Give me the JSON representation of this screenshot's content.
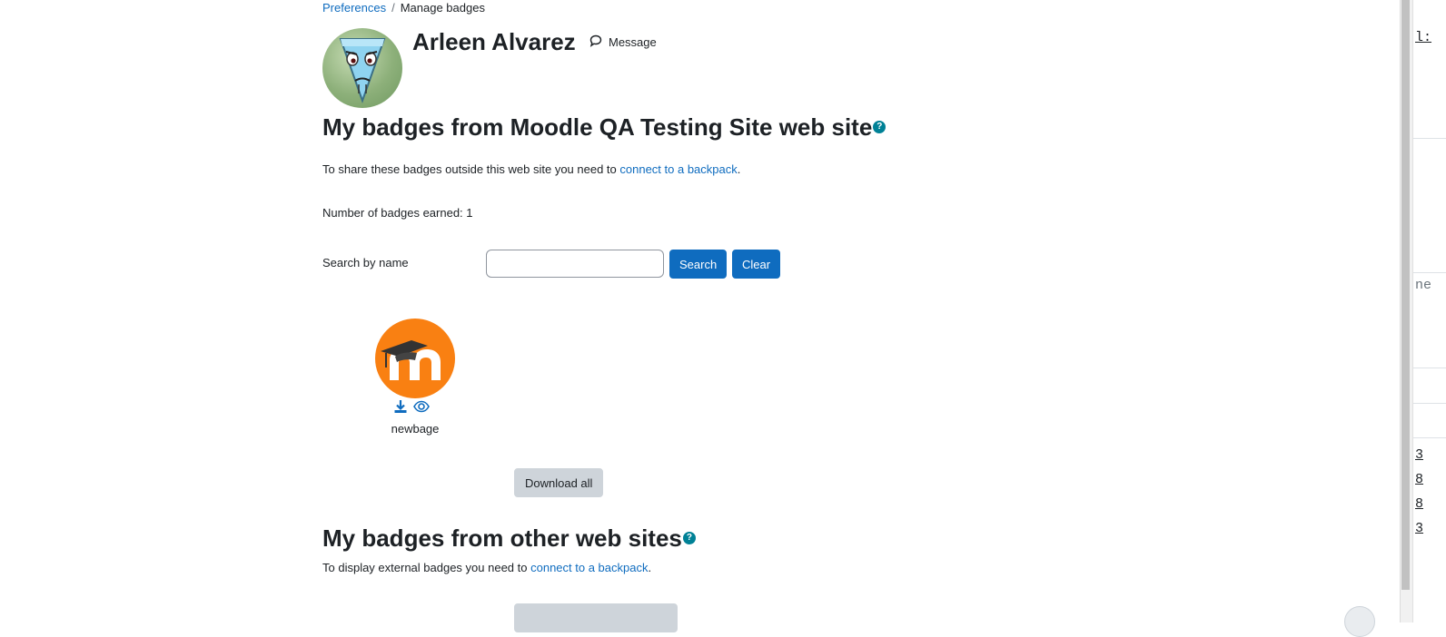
{
  "breadcrumb": {
    "parent": "Preferences",
    "separator": "/",
    "current": "Manage badges"
  },
  "user": {
    "name": "Arleen Alvarez",
    "message_label": "Message"
  },
  "local_section": {
    "title": "My badges from Moodle QA Testing Site web site",
    "help_icon": "?",
    "share_text_prefix": "To share these badges outside this web site you need to ",
    "share_link": "connect to a backpack",
    "share_text_suffix": ".",
    "count_text": "Number of badges earned: 1",
    "search_label": "Search by name",
    "search_value": "",
    "search_button": "Search",
    "clear_button": "Clear",
    "badges": [
      {
        "name": "newbage",
        "actions": [
          "download-icon",
          "view-icon"
        ]
      }
    ],
    "download_all_button": "Download all"
  },
  "external_section": {
    "title": "My badges from other web sites",
    "help_icon": "?",
    "text_prefix": "To display external badges you need to ",
    "link": "connect to a backpack",
    "text_suffix": "."
  },
  "right_panel": {
    "fragments": [
      "l:",
      "ne",
      "3",
      "8",
      "8",
      "3"
    ]
  },
  "colors": {
    "link": "#0f6cbf",
    "primary_button": "#0f6cbf",
    "secondary_button": "#ced4da",
    "help_icon": "#008196",
    "badge_orange": "#f98012"
  }
}
